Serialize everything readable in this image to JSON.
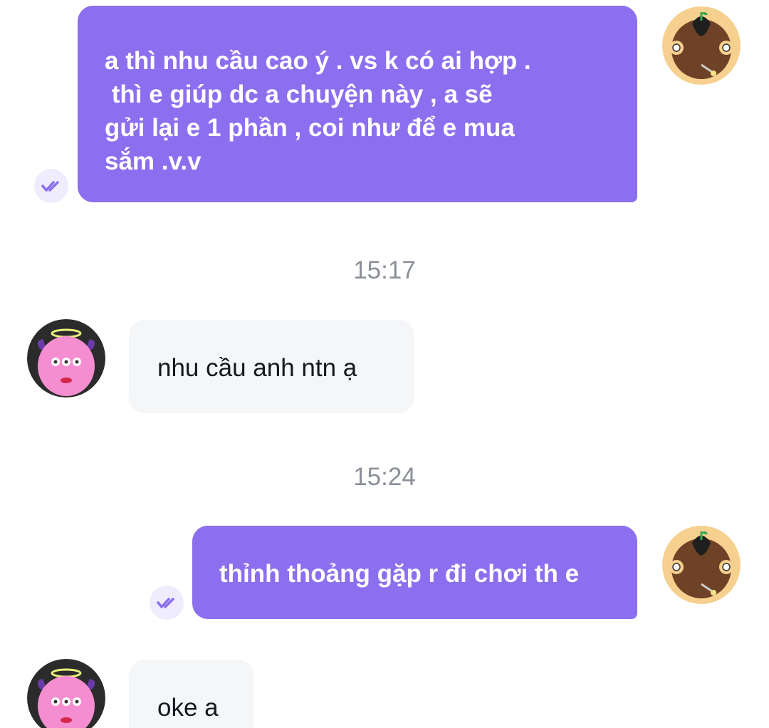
{
  "messages": [
    {
      "direction": "outgoing",
      "lines": [
        "a thì nhu cầu cao ý . vs k có ai hợp .",
        " thì e giúp dc a chuyện này , a sẽ",
        "gửi lại e 1 phần , coi như để e mua",
        "sắm .v.v"
      ],
      "status_icon": "double-check-icon"
    },
    {
      "time": "15:17"
    },
    {
      "direction": "incoming",
      "text": "nhu cầu anh ntn ạ"
    },
    {
      "time": "15:24"
    },
    {
      "direction": "outgoing",
      "text": "thỉnh thoảng gặp r đi chơi th e",
      "status_icon": "double-check-icon"
    },
    {
      "direction": "incoming",
      "text": "oke a"
    }
  ],
  "colors": {
    "outgoing_bubble": "#8c6fee",
    "incoming_bubble": "#f5f6f8",
    "timestamp": "#8a8f99"
  },
  "avatars": {
    "self": "monkey-avatar-icon",
    "contact": "pink-monster-avatar-icon"
  }
}
